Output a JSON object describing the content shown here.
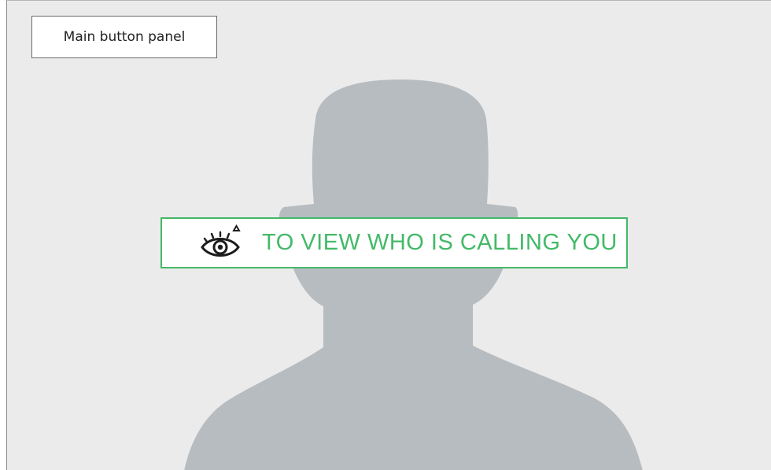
{
  "panel": {
    "label": "Main button panel"
  },
  "caller_overlay": {
    "button_label": "TO VIEW WHO IS CALLING YOU",
    "icon": "eye-icon",
    "accent_color": "#43b968"
  },
  "background": {
    "placeholder": "person-silhouette",
    "silhouette_color": "#b7bcc1",
    "background_color": "#ebebeb"
  }
}
